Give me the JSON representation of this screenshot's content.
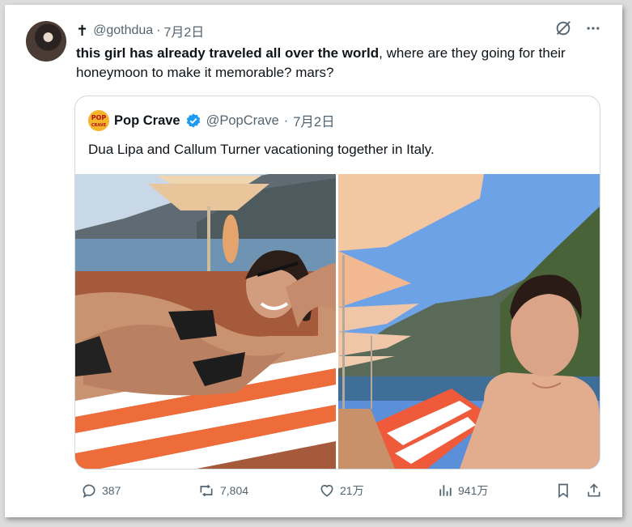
{
  "tweet": {
    "prefix_symbol": "✝",
    "handle": "@gothdua",
    "separator": "·",
    "date": "7月2日",
    "text_bold": "this girl has already traveled all over the world",
    "text_rest": ", where are they going for their honeymoon to make it memorable? mars?"
  },
  "quote": {
    "logo_text_1": "POP",
    "logo_text_2": "CRAVE",
    "name": "Pop Crave",
    "handle": "@PopCrave",
    "separator": "·",
    "date": "7月2日",
    "text": "Dua Lipa and Callum Turner vacationing together in Italy."
  },
  "actions": {
    "replies": "387",
    "reposts": "7,804",
    "likes": "21万",
    "views": "941万"
  },
  "colors": {
    "muted": "#536471",
    "verified": "#1d9bf0",
    "text": "#0f1419",
    "border": "#cfd9de"
  }
}
